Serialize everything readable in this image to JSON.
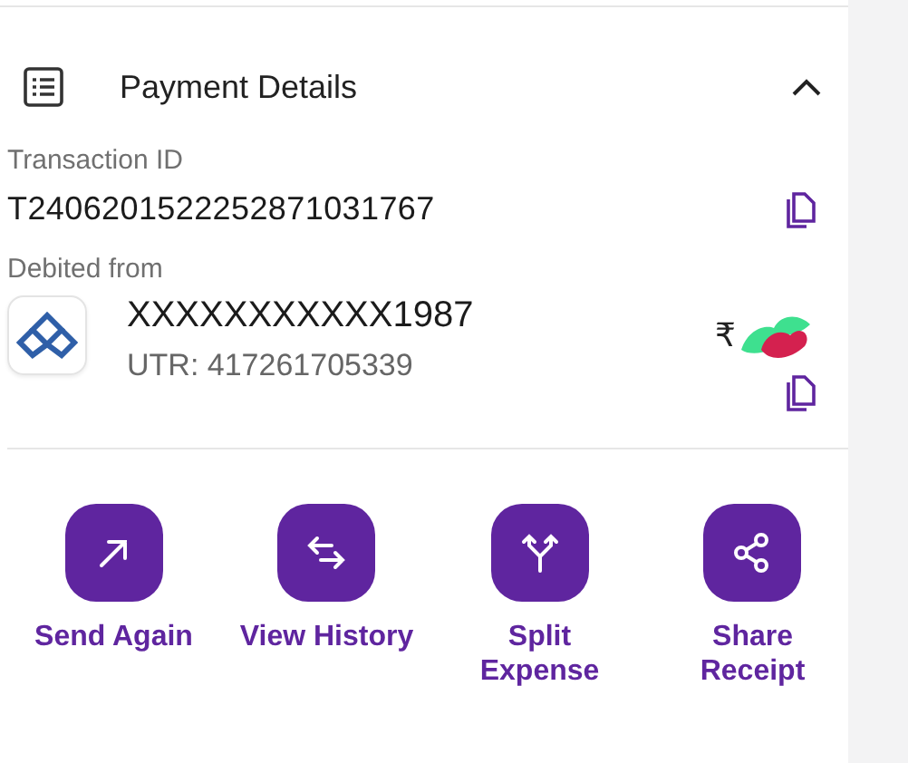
{
  "section": {
    "title": "Payment Details",
    "expanded": true
  },
  "transaction": {
    "label": "Transaction ID",
    "value": "T2406201522252871031767"
  },
  "debit": {
    "label": "Debited from",
    "account": "XXXXXXXXXXX1987",
    "utr": "UTR: 417261705339",
    "amount": "₹"
  },
  "actions": [
    {
      "label": "Send Again"
    },
    {
      "label": "View History"
    },
    {
      "label": "Split Expense"
    },
    {
      "label": "Share Receipt"
    }
  ]
}
